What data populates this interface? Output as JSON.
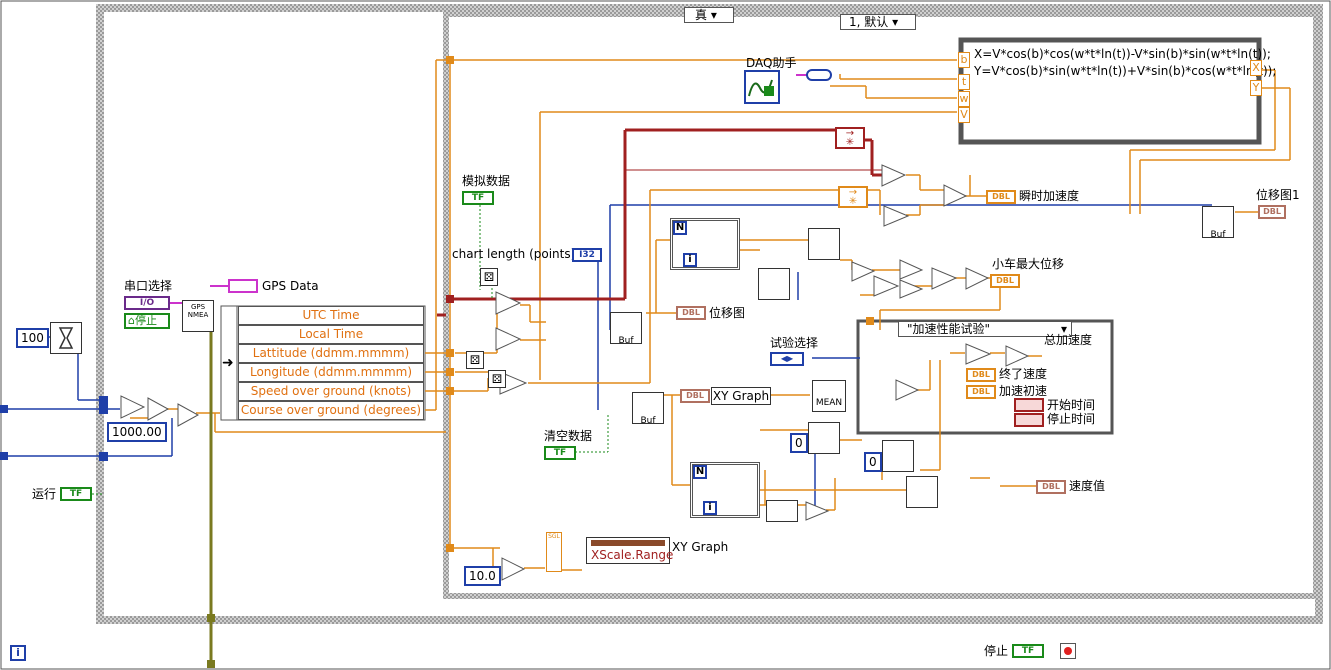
{
  "labels": {
    "serial": "串口选择",
    "gps_data": "GPS Data",
    "stop_ctrl": "停止",
    "run": "运行",
    "sim_data": "模拟数据",
    "chart_length": "chart length (points)",
    "daq": "DAQ助手",
    "inst_accel": "瞬时加速度",
    "disp_graph1": "位移图1",
    "max_disp": "小车最大位移",
    "disp_graph": "位移图",
    "test_select": "试验选择",
    "avg_accel": "总加速度",
    "final_speed": "终了速度",
    "init_speed": "加速初速",
    "start_time": "开始时间",
    "stop_time": "停止时间",
    "clear_data": "清空数据",
    "speed_val": "速度值",
    "xy_graph": "XY Graph",
    "xy_graph_label": "XY Graph",
    "xscale": "XScale.Range",
    "stop_bottom": "停止"
  },
  "structures": {
    "case_true": "真",
    "case_default": "1, 默认",
    "inner_case": "\"加速性能试验\""
  },
  "constants": {
    "c100": "100",
    "c1000": "1000.00",
    "c10": "10.0",
    "c0a": "0",
    "c0b": "0",
    "mean": "MEAN",
    "io": "I/O",
    "stop_enum": "停止",
    "i32": "I32",
    "n": "N",
    "i": "i"
  },
  "gps_fields": [
    "UTC Time",
    "Local Time",
    "Lattitude (ddmm.mmmm)",
    "Longitude (ddmm.mmmm)",
    "Speed over ground (knots)",
    "Course over ground (degrees)"
  ],
  "formula": [
    "X=V*cos(b)*cos(w*t*ln(t))-V*sin(b)*sin(w*t*ln(t));",
    "Y=V*cos(b)*sin(w*t*ln(t))+V*sin(b)*cos(w*t*ln(t));"
  ],
  "formula_inputs": [
    "b",
    "t",
    "w",
    "V"
  ],
  "formula_outputs": [
    "X",
    "Y"
  ],
  "terminals": {
    "tf": "TF",
    "dbl": "DBL",
    "sgl": "SGL",
    "buf": "Buf",
    "gps_icon": "GPS NMEA"
  },
  "colors": {
    "orange_wire": "#e08a1a",
    "blue_wire": "#1f3fa8",
    "green_wire": "#1a8a1a",
    "magenta": "#cc33cc",
    "frame_gray": "#8a8a8a",
    "dark_red": "#a02020"
  }
}
